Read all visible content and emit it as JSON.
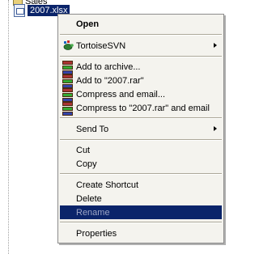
{
  "explorer": {
    "top_item_label": "Sales",
    "selected_file": "2007.xlsx"
  },
  "menu": {
    "open": "Open",
    "tortoise": "TortoiseSVN",
    "add_archive": "Add to archive...",
    "add_rar": "Add to \"2007.rar\"",
    "compress_email": "Compress and email...",
    "compress_rar_email": "Compress to \"2007.rar\" and email",
    "send_to": "Send To",
    "cut": "Cut",
    "copy": "Copy",
    "create_shortcut": "Create Shortcut",
    "delete": "Delete",
    "rename": "Rename",
    "properties": "Properties"
  },
  "colors": {
    "selection": "#0a246a",
    "menu_bg": "#f4f3ee",
    "disabled_text": "#8d8d8d"
  }
}
